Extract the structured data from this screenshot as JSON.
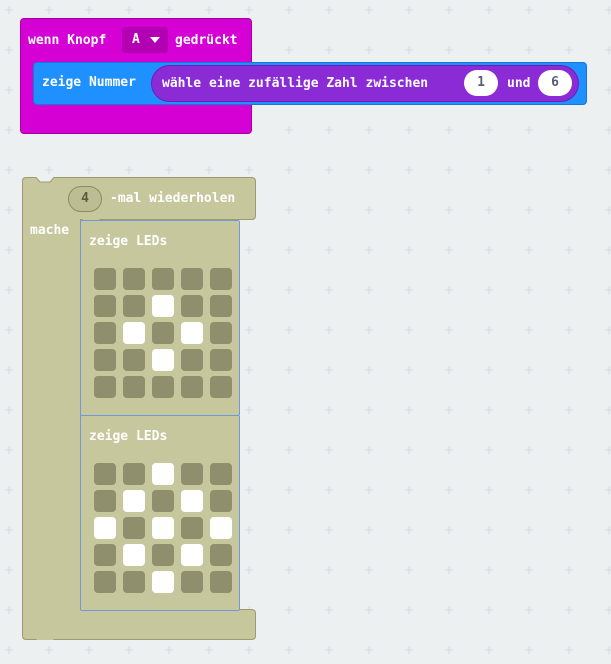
{
  "event_block": {
    "prefix": "wenn Knopf",
    "button_value": "A",
    "suffix": "gedrückt",
    "color": "#d400d4"
  },
  "show_number": {
    "label": "zeige Nummer",
    "color": "#1e90ff"
  },
  "random": {
    "label": "wähle eine zufällige Zahl zwischen",
    "min": "1",
    "conjunction": "und",
    "max": "6",
    "color": "#8a2bd6"
  },
  "repeat_block": {
    "count": "4",
    "label": "-mal wiederholen",
    "do_label": "mache",
    "color": "#c7c79d"
  },
  "led_blocks": [
    {
      "label": "zeige LEDs",
      "pattern": [
        [
          0,
          0,
          0,
          0,
          0
        ],
        [
          0,
          0,
          1,
          0,
          0
        ],
        [
          0,
          1,
          0,
          1,
          0
        ],
        [
          0,
          0,
          1,
          0,
          0
        ],
        [
          0,
          0,
          0,
          0,
          0
        ]
      ]
    },
    {
      "label": "zeige LEDs",
      "pattern": [
        [
          0,
          0,
          1,
          0,
          0
        ],
        [
          0,
          1,
          0,
          1,
          0
        ],
        [
          1,
          0,
          1,
          0,
          1
        ],
        [
          0,
          1,
          0,
          1,
          0
        ],
        [
          0,
          0,
          1,
          0,
          0
        ]
      ]
    }
  ]
}
